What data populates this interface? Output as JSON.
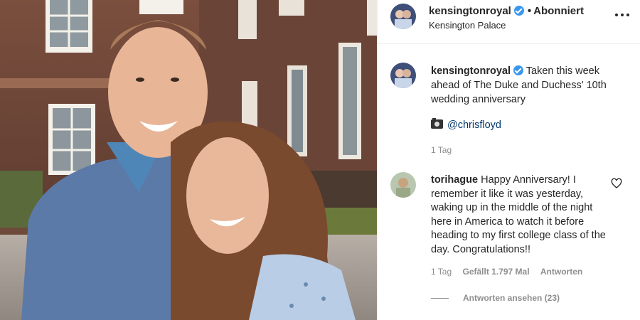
{
  "post": {
    "username": "kensingtonroyal",
    "separator": "•",
    "follow_status": "Abonniert",
    "location": "Kensington Palace",
    "caption": "Taken this week ahead of The Duke and Duchess' 10th wedding anniversary",
    "photo_credit": "@chrisfloyd",
    "time_ago": "1 Tag"
  },
  "comment": {
    "username": "torihague",
    "text": "Happy Anniversary! I remember it like it was yesterday, waking up in the middle of the night here in America to watch it before heading to my first college class of the day. Congratulations!!",
    "time_ago": "1 Tag",
    "likes": "Gefällt 1.797 Mal",
    "reply_label": "Antworten",
    "view_replies": "Antworten ansehen (23)"
  },
  "icons": {
    "verified": "verified-badge-icon",
    "more": "more-options-icon",
    "camera": "camera-icon",
    "heart": "heart-outline-icon"
  },
  "colors": {
    "verified": "#3897f0",
    "link": "#00376b",
    "muted": "#8e8e8e"
  }
}
